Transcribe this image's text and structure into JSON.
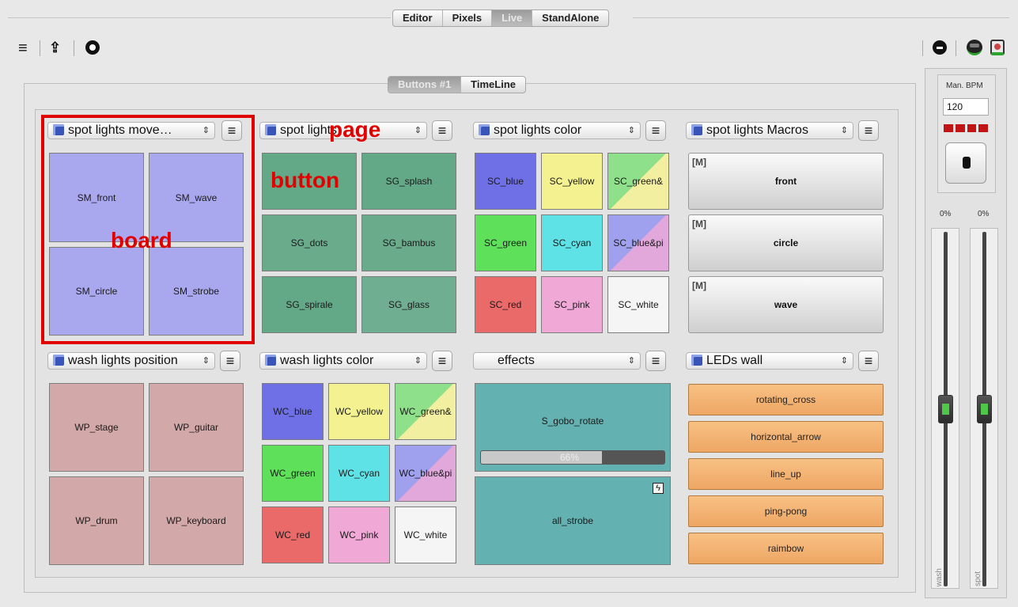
{
  "top_tabs": [
    "Editor",
    "Pixels",
    "Live",
    "StandAlone"
  ],
  "active_top_tab": "Live",
  "toolbar": {
    "menu_icon": "hamburger-icon",
    "export_icon": "export-icon",
    "record_icon": "record-icon",
    "stop_icon": "stop-icon",
    "green_icon": "green-face-icon",
    "sync_icon": "sync-icon"
  },
  "sub_tabs": [
    "Buttons #1",
    "TimeLine"
  ],
  "active_sub_tab": "Buttons #1",
  "annotations": {
    "board": "board",
    "page": "page",
    "button": "button"
  },
  "boards": [
    {
      "title": "spot lights move…",
      "cells": [
        "SM_front",
        "SM_wave",
        "SM_circle",
        "SM_strobe"
      ]
    },
    {
      "title": "spot lights",
      "cells": [
        "",
        "SG_splash",
        "SG_dots",
        "SG_bambus",
        "SG_spirale",
        "SG_glass"
      ]
    },
    {
      "title": "spot lights color",
      "cells": [
        "SC_blue",
        "SC_yellow",
        "SC_green&",
        "SC_green",
        "SC_cyan",
        "SC_blue&pi",
        "SC_red",
        "SC_pink",
        "SC_white"
      ]
    },
    {
      "title": "spot lights Macros",
      "cells": [
        "front",
        "circle",
        "wave"
      ],
      "macro_mark": "[M]"
    },
    {
      "title": "wash lights position",
      "cells": [
        "WP_stage",
        "WP_guitar",
        "WP_drum",
        "WP_keyboard"
      ]
    },
    {
      "title": "wash lights color",
      "cells": [
        "WC_blue",
        "WC_yellow",
        "WC_green&",
        "WC_green",
        "WC_cyan",
        "WC_blue&pi",
        "WC_red",
        "WC_pink",
        "WC_white"
      ]
    },
    {
      "title": "effects",
      "cells": [
        "S_gobo_rotate",
        "all_strobe"
      ],
      "progress_label": "66%",
      "progress": 0.66,
      "flash_mark": "ϟ"
    },
    {
      "title": "LEDs wall",
      "cells": [
        "rotating_cross",
        "horizontal_arrow",
        "line_up",
        "ping-pong",
        "raimbow"
      ]
    }
  ],
  "bpm": {
    "label": "Man. BPM",
    "value": "120"
  },
  "faders": [
    {
      "name": "wash",
      "percent": "0%"
    },
    {
      "name": "spot",
      "percent": "0%"
    }
  ],
  "colors": {
    "blue": "#6f70e6",
    "yellow": "#f4f290",
    "green": "#5ee05a",
    "cyan": "#5fe2e6",
    "red": "#ea6a6a",
    "pink": "#f0a8d6",
    "white": "#f5f5f5",
    "sm": "#a9a7ee",
    "sg": "#63a987",
    "wp": "#d3a8a8",
    "teal": "#64b1b1",
    "led": "#f3b375"
  }
}
